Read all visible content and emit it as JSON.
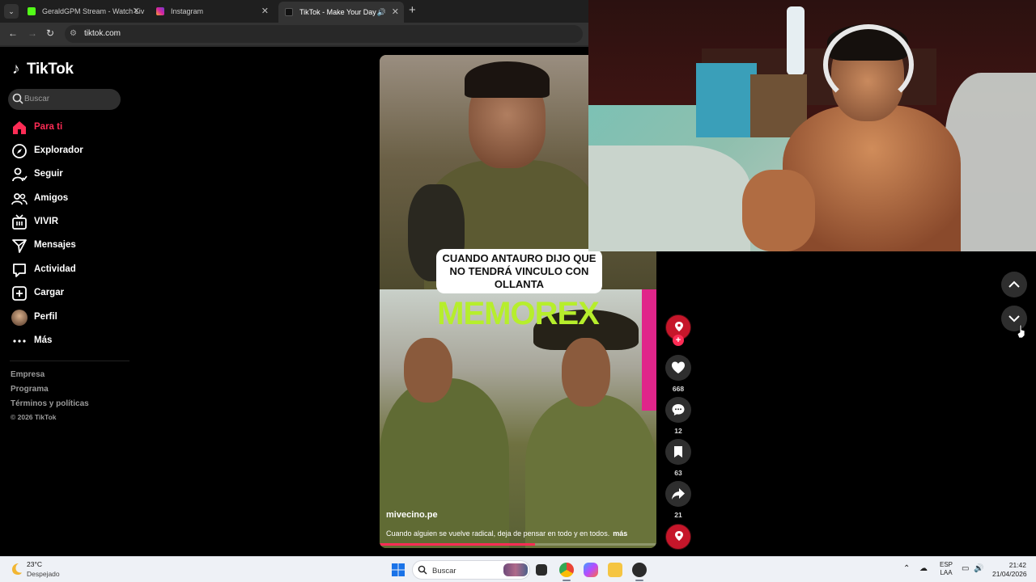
{
  "browser": {
    "tabs": [
      {
        "title": "GeraldGPM Stream - Watch Liv",
        "favicon_color": "#53fc18",
        "active": false
      },
      {
        "title": "Instagram",
        "favicon_color": "#d6249f",
        "active": false
      },
      {
        "title": "TikTok - Make Your Day",
        "favicon_color": "#000000",
        "active": true
      }
    ],
    "url": "tiktok.com"
  },
  "sidebar": {
    "logo": "TikTok",
    "search_placeholder": "Buscar",
    "items": [
      {
        "label": "Para ti",
        "icon": "home-icon",
        "active": true
      },
      {
        "label": "Explorador",
        "icon": "compass-icon",
        "active": false
      },
      {
        "label": "Seguir",
        "icon": "follow-user-icon",
        "active": false
      },
      {
        "label": "Amigos",
        "icon": "friends-icon",
        "active": false
      },
      {
        "label": "VIVIR",
        "icon": "live-tv-icon",
        "active": false
      },
      {
        "label": "Mensajes",
        "icon": "send-icon",
        "active": false
      },
      {
        "label": "Actividad",
        "icon": "message-box-icon",
        "active": false
      },
      {
        "label": "Cargar",
        "icon": "upload-plus-icon",
        "active": false
      },
      {
        "label": "Perfil",
        "icon": "avatar",
        "active": false
      },
      {
        "label": "Más",
        "icon": "more-dots-icon",
        "active": false
      }
    ],
    "footer": [
      "Empresa",
      "Programa",
      "Términos y políticas"
    ],
    "copyright": "© 2026 TikTok"
  },
  "video": {
    "overlay_text": "CUANDO ANTAURO DIJO QUE NO TENDRÁ VINCULO CON OLLANTA",
    "memorex": "MEMOREX",
    "username": "mivecino.pe",
    "description": "Cuando alguien se vuelve radical, deja de pensar en todo y en todos.",
    "more_label": "más",
    "progress": 0.56
  },
  "actions": {
    "likes": "668",
    "comments": "12",
    "saves": "63",
    "shares": "21",
    "follow_plus": "+"
  },
  "taskbar": {
    "weather_temp": "23°C",
    "weather_desc": "Despejado",
    "search_placeholder": "Buscar",
    "lang_top": "ESP",
    "lang_bottom": "LAA",
    "time": "21:42",
    "date": "21/04/2026"
  },
  "colors": {
    "accent": "#fe2c55",
    "memorex": "#b6ee2c"
  }
}
